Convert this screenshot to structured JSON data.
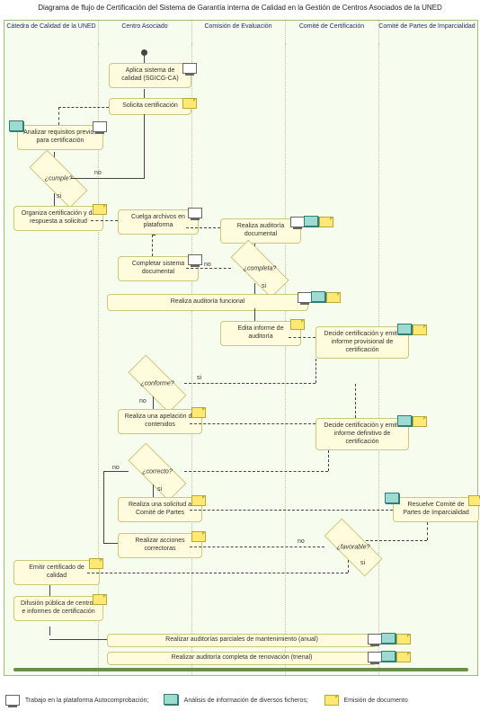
{
  "title": "Diagrama de flujo de Certificación del Sistema de Garantía interna de Calidad en la Gestión de Centros Asociados de la UNED",
  "lanes": {
    "l1": "Cátedra de Calidad de la UNED",
    "l2": "Centro Asociado",
    "l3": "Comisión de Evaluación",
    "l4": "Comité de Certificación",
    "l5": "Comité de Partes de Imparcialidad"
  },
  "nodes": {
    "aplica": "Aplica sistema de calidad (SGICG-CA)",
    "solicita": "Solicita certificación",
    "analizar": "Analizar requisitos previos para certificación",
    "organiza": "Organiza certificación y da respuesta a solicitud",
    "cuelga": "Cuelga archivos en plataforma",
    "realizaDoc": "Realiza auditoría documental",
    "completar": "Completar sistema documental",
    "realizaFunc": "Realiza auditoría funcional",
    "edita": "Edita informe de auditoría",
    "decideProv": "Decide certificación y emite informe provisional de certificación",
    "apelacion": "Realiza una apelación de contenidos",
    "decideDef": "Decide certificación y emite informe definitivo de certificación",
    "solComite": "Realiza una solicitud a Comité de Partes",
    "resuelve": "Resuelve Comité de Partes de Imparcialidad",
    "acciones": "Realizar acciones correctoras",
    "emitir": "Emitir certificado de calidad",
    "difusion": "Difusión pública de centros e informes de certificación",
    "audAnual": "Realizar auditorías parciales de mantenimiento (anual)",
    "audTrienal": "Realizar auditoría completa de renovación (trienal)"
  },
  "decisions": {
    "cumple": "¿cumple?",
    "completa": "¿completa?",
    "conforme": "¿conforme?",
    "correcto": "¿correcto?",
    "favorable": "¿favorable?"
  },
  "labels": {
    "si": "si",
    "no": "no"
  },
  "legend": {
    "comp": "Trabajo en la plataforma Autocomprobación;",
    "stack": "Análisis de información de diversos ficheros;",
    "doc": "Emisión de documento"
  }
}
